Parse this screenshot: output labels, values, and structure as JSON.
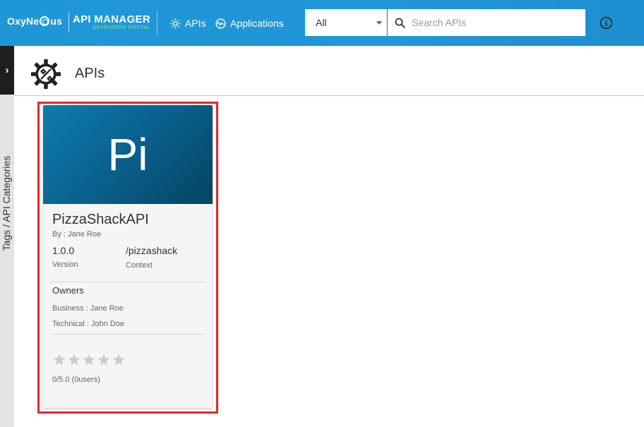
{
  "header": {
    "logo_left": "OxyNe",
    "logo_right": "us",
    "brand_main": "API MANAGER",
    "brand_sub": "DEVELOPER PORTAL",
    "nav": [
      {
        "label": "APIs",
        "icon": "gear-icon"
      },
      {
        "label": "Applications",
        "icon": "applications-icon"
      }
    ],
    "filter_select": {
      "value": "All"
    },
    "search": {
      "placeholder": "Search APIs",
      "value": ""
    },
    "info_icon": "info-icon"
  },
  "sidebar": {
    "toggle_glyph": "›",
    "label": "Tags / API Categories"
  },
  "page": {
    "title": "APIs",
    "icon": "api-settings-icon"
  },
  "api_card": {
    "thumbnail_text": "Pi",
    "name": "PizzaShackAPI",
    "by": "By : Jane Roe",
    "version": "1.0.0",
    "version_label": "Version",
    "context": "/pizzashack",
    "context_label": "Context",
    "owners_title": "Owners",
    "business_owner": "Business :  Jane Roe",
    "technical_owner": "Technical :  John Doe",
    "rating": 0,
    "rating_max": 5,
    "rating_text": "0/5.0 (0users)"
  },
  "colors": {
    "header_bg": "#2196d8",
    "highlight_border": "#e3262b",
    "thumbnail_bg": "#0a6391",
    "star_empty": "#cccccc"
  }
}
